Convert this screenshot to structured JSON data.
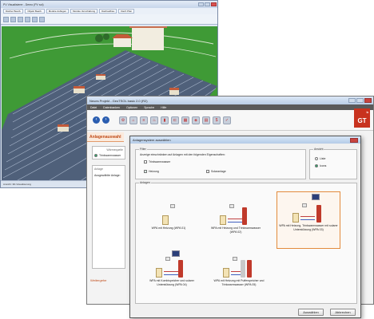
{
  "app3d": {
    "title": "PV Visualisierer - Demo (PV sol)",
    "tabs": [
      "Dächer Bearb.",
      "Objekt Bearb.",
      "Module Auflegen",
      "Module Verschaltung",
      "Dachaufbau",
      "Dach Plan"
    ],
    "status": "Ansicht: 3D-Visualisierung"
  },
  "main": {
    "title": "Neues Projekt - GeoTSOL basic 2.0 (R2)",
    "menu": [
      "Datei",
      "Datenbanken",
      "Optionen",
      "Sprache",
      "Hilfe"
    ],
    "logo_text": "GT",
    "logo_sup": "b",
    "page_title": "Anlagenauswahl",
    "warmequelle_label": "Wärmequelle",
    "warmequelle_value": "Trinkwarmwasser",
    "anlage_label": "Anlage",
    "anlage_value": "Ausgewählte Anlage:",
    "weitere": "Weitergehe"
  },
  "dialog": {
    "title": "Anlagensystem auswählen",
    "filter_label": "Filter",
    "filter_text": "Anzeige einschränken auf Anlagen mit den folgenden Eigenschaften:",
    "filter_options": [
      {
        "label": "Trinkwarmwasser",
        "checked": false
      },
      {
        "label": "Heizung",
        "checked": true
      },
      {
        "label": "Solaranlage",
        "checked": false
      }
    ],
    "ansicht_label": "Ansicht",
    "ansicht_options": [
      {
        "label": "Liste",
        "selected": false
      },
      {
        "label": "Icons",
        "selected": true
      }
    ],
    "anlagen_label": "Anlagen",
    "systems": [
      {
        "caption": "WPA mit Heizung (WPA 01)",
        "solar": false,
        "tanks": 0,
        "selected": false
      },
      {
        "caption": "WPA mit Heizung und Trinkwarmwasser (WPA 02)",
        "solar": false,
        "tanks": 1,
        "selected": false
      },
      {
        "caption": "WPA mit Heizung, Trinkwarmwasser mit solarer Unterstützung (WPA 03)",
        "solar": true,
        "tanks": 1,
        "selected": true
      },
      {
        "caption": "WPA mit Kombispeicher und solarer Unterstützung (WPA 04)",
        "solar": true,
        "tanks": 1,
        "selected": false
      },
      {
        "caption": "WPA mit Heizung mit Pufferspeicher und Trinkwarmwasser (WPA 05)",
        "solar": false,
        "tanks": 2,
        "selected": false
      }
    ],
    "ok_label": "Auswählen",
    "cancel_label": "Abbrechen"
  }
}
